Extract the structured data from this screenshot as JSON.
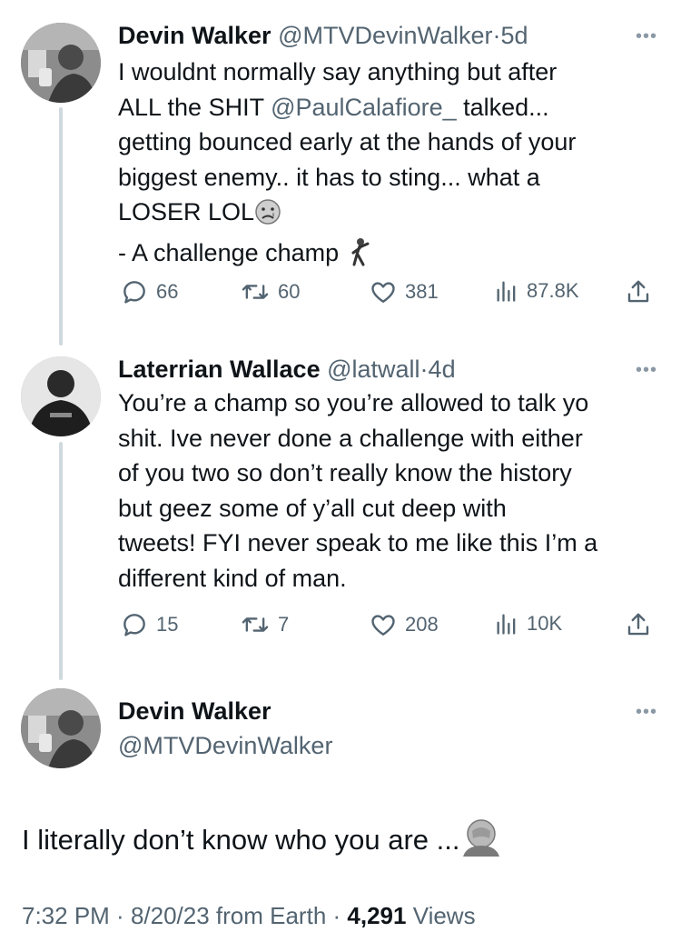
{
  "tweets": [
    {
      "name": "Devin Walker",
      "handle": "@MTVDevinWalker",
      "dot": "·",
      "time": "5d",
      "more": "•••",
      "line1": "I wouldnt normally say anything but after",
      "line2_pre": "ALL the SHIT ",
      "line2_mention": "@PaulCalafiore_",
      "line2_post": " talked...",
      "line3": "getting bounced early at the hands of your",
      "line4": "biggest enemy.. it has to sting... what a",
      "line5": "LOSER LOL",
      "line6": "- A challenge champ",
      "replies": "66",
      "retweets": "60",
      "likes": "381",
      "views": "87.8K"
    },
    {
      "name": "Laterrian Wallace",
      "handle": "@latwall",
      "dot": "·",
      "time": "4d",
      "more": "•••",
      "line1": "You’re a champ so you’re allowed to talk yo",
      "line2": "shit. Ive never done a challenge with either",
      "line3": "of you two so don’t really know the history",
      "line4": "but geez some of y’all cut deep with",
      "line5": "tweets! FYI never speak to me like this I’m a",
      "line6": "different kind of man.",
      "replies": "15",
      "retweets": "7",
      "likes": "208",
      "views": "10K"
    }
  ],
  "main": {
    "name": "Devin Walker",
    "handle": "@MTVDevinWalker",
    "more": "•••",
    "text": "I literally don’t know who you are ...",
    "time": "7:32 PM",
    "sep1": " · ",
    "date": "8/20/23",
    "source": " from Earth",
    "sep2": " · ",
    "view_count": "4,291",
    "views_label": " Views"
  }
}
